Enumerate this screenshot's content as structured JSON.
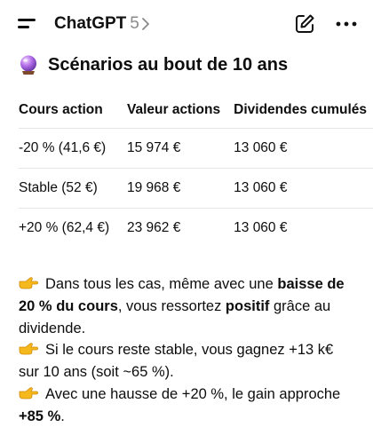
{
  "header": {
    "app_name": "ChatGPT",
    "version": "5",
    "menu_icon": "hamburger-icon",
    "new_chat_icon": "edit-icon",
    "more_icon": "more-icon"
  },
  "section": {
    "emoji": "crystal-ball-icon",
    "title": "Scénarios au bout de 10 ans"
  },
  "table": {
    "headers": [
      "Cours action",
      "Valeur actions",
      "Dividendes cumulés"
    ],
    "rows": [
      [
        "-20 % (41,6 €)",
        "15 974 €",
        "13 060 €"
      ],
      [
        "Stable (52 €)",
        "19 968 €",
        "13 060 €"
      ],
      [
        "+20 % (62,4 €)",
        "23 962 €",
        "13 060 €"
      ]
    ]
  },
  "bullets": {
    "b1_a": "Dans tous les cas, même avec une ",
    "b1_b": "baisse de 20 % du cours",
    "b1_c": ", vous ressortez ",
    "b1_d": "positif",
    "b1_e": " grâce au dividende.",
    "b2": "Si le cours reste stable, vous gagnez +13 k€ sur 10 ans (soit ~65 %).",
    "b3_a": "Avec une hausse de +20 %, le gain approche ",
    "b3_b": "+85 %",
    "b3_c": "."
  },
  "colors": {
    "text": "#0d0d0d",
    "muted": "#8a8a8a",
    "divider": "#e5e5e5",
    "pointing_hand": "#f5b91e"
  }
}
